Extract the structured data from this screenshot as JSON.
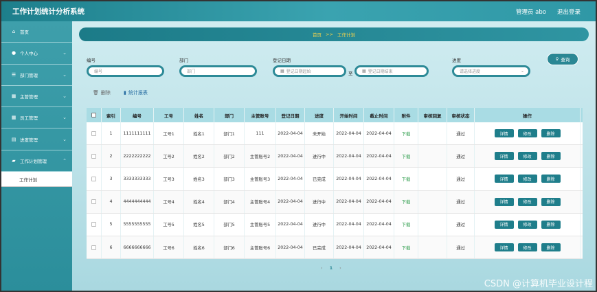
{
  "app": {
    "title": "工作计划统计分析系统",
    "user": "管理员 abo",
    "logout": "退出登录"
  },
  "sidebar": {
    "items": [
      {
        "label": "首页",
        "icon": "home-icon"
      },
      {
        "label": "个人中心",
        "icon": "user-icon"
      },
      {
        "label": "部门管理",
        "icon": "sliders-icon"
      },
      {
        "label": "主管管理",
        "icon": "grid-icon"
      },
      {
        "label": "员工管理",
        "icon": "grid-icon"
      },
      {
        "label": "进度管理",
        "icon": "doc-icon"
      },
      {
        "label": "工作计划管理",
        "icon": "briefcase-icon"
      }
    ],
    "sub_item": "工作计划"
  },
  "breadcrumb": {
    "home": "首页",
    "sep": ">>",
    "current": "工作计划"
  },
  "filters": {
    "bianhao_label": "编号",
    "bianhao_placeholder": "编号",
    "bumen_label": "部门",
    "bumen_placeholder": "部门",
    "date_label": "登记日期",
    "date_start_placeholder": "登记日期起始",
    "date_sep": "至",
    "date_end_placeholder": "登记日期结束",
    "jindu_label": "进度",
    "jindu_placeholder": "请选择进度",
    "query_label": "查询"
  },
  "actions": {
    "delete_label": "删除",
    "stats_label": "统计报表"
  },
  "table": {
    "headers": [
      "索引",
      "编号",
      "工号",
      "姓名",
      "部门",
      "主管账号",
      "登记日期",
      "进度",
      "开始时间",
      "截止时间",
      "附件",
      "审核回复",
      "审核状态",
      "操作"
    ],
    "rows": [
      {
        "idx": "1",
        "bianhao": "1111111111",
        "gonghao": "工号1",
        "name": "姓名1",
        "dept": "部门1",
        "mgr": "111",
        "date": "2022-04-04",
        "progress": "未开始",
        "start": "2022-04-04",
        "end": "2022-04-04",
        "file": "下载",
        "reply": "",
        "status": "通过"
      },
      {
        "idx": "2",
        "bianhao": "2222222222",
        "gonghao": "工号2",
        "name": "姓名2",
        "dept": "部门2",
        "mgr": "主管账号2",
        "date": "2022-04-04",
        "progress": "进行中",
        "start": "2022-04-04",
        "end": "2022-04-04",
        "file": "下载",
        "reply": "",
        "status": "通过"
      },
      {
        "idx": "3",
        "bianhao": "3333333333",
        "gonghao": "工号3",
        "name": "姓名3",
        "dept": "部门3",
        "mgr": "主管账号3",
        "date": "2022-04-04",
        "progress": "已完成",
        "start": "2022-04-04",
        "end": "2022-04-04",
        "file": "下载",
        "reply": "",
        "status": "通过"
      },
      {
        "idx": "4",
        "bianhao": "4444444444",
        "gonghao": "工号4",
        "name": "姓名4",
        "dept": "部门4",
        "mgr": "主管账号4",
        "date": "2022-04-04",
        "progress": "进行中",
        "start": "2022-04-04",
        "end": "2022-04-04",
        "file": "下载",
        "reply": "",
        "status": "通过"
      },
      {
        "idx": "5",
        "bianhao": "5555555555",
        "gonghao": "工号5",
        "name": "姓名5",
        "dept": "部门5",
        "mgr": "主管账号5",
        "date": "2022-04-04",
        "progress": "进行中",
        "start": "2022-04-04",
        "end": "2022-04-04",
        "file": "下载",
        "reply": "",
        "status": "通过"
      },
      {
        "idx": "6",
        "bianhao": "6666666666",
        "gonghao": "工号6",
        "name": "姓名6",
        "dept": "部门6",
        "mgr": "主管账号6",
        "date": "2022-04-04",
        "progress": "已完成",
        "start": "2022-04-04",
        "end": "2022-04-04",
        "file": "下载",
        "reply": "",
        "status": "通过"
      }
    ],
    "btn_detail": "详情",
    "btn_edit": "修改",
    "btn_delete": "删除"
  },
  "pager": {
    "prev": "‹",
    "page": "1",
    "next": "›"
  },
  "watermark": "CSDN @计算机毕业设计程"
}
